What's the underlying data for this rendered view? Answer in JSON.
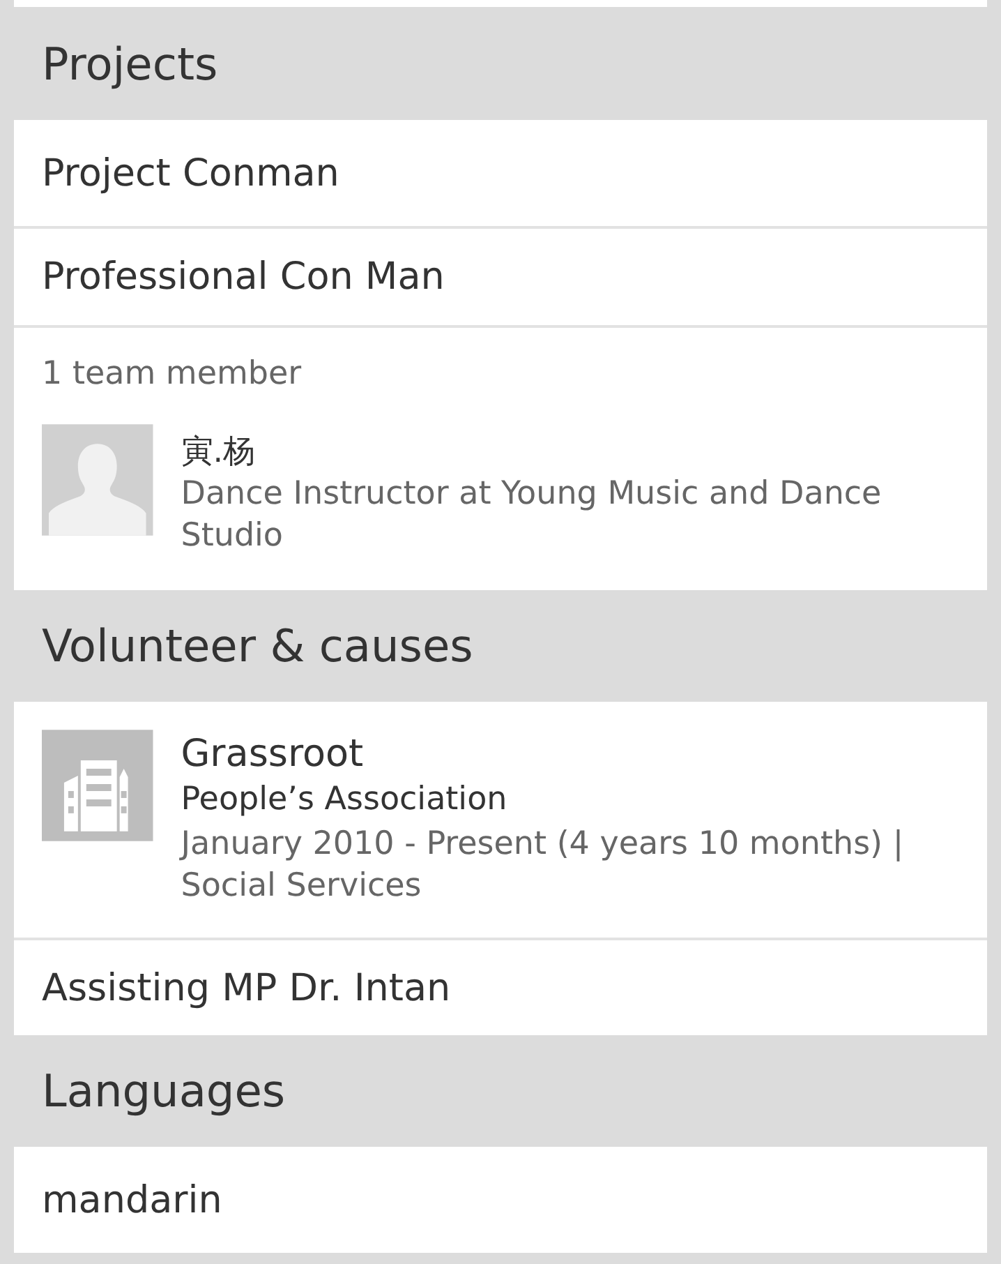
{
  "sections": [
    {
      "kind": "projects",
      "title": "Projects",
      "items": [
        {
          "name": "Project Conman",
          "description": "Professional Con Man",
          "team_label": "1 team member",
          "members": [
            {
              "name": "寅.杨",
              "headline": "Dance Instructor at Young Music and Dance Studio"
            }
          ]
        }
      ]
    },
    {
      "kind": "volunteer",
      "title": "Volunteer & causes",
      "items": [
        {
          "role": "Grassroot",
          "organization": "People’s Association",
          "period": "January 2010 - Present (4 years 10 months) | Social Services",
          "description": "Assisting MP Dr. Intan"
        }
      ]
    },
    {
      "kind": "languages",
      "title": "Languages",
      "items": [
        {
          "name": "mandarin"
        }
      ]
    }
  ]
}
